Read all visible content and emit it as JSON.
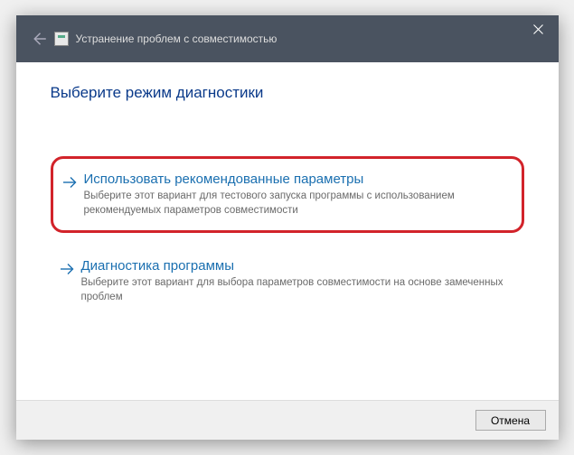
{
  "titlebar": {
    "window_title": "Устранение проблем с совместимостью"
  },
  "content": {
    "heading": "Выберите режим диагностики",
    "options": [
      {
        "title": "Использовать рекомендованные параметры",
        "description": "Выберите этот вариант для тестового запуска программы с использованием рекомендуемых параметров совместимости"
      },
      {
        "title": "Диагностика программы",
        "description": "Выберите этот вариант для выбора параметров совместимости на основе замеченных проблем"
      }
    ]
  },
  "footer": {
    "cancel_label": "Отмена"
  }
}
